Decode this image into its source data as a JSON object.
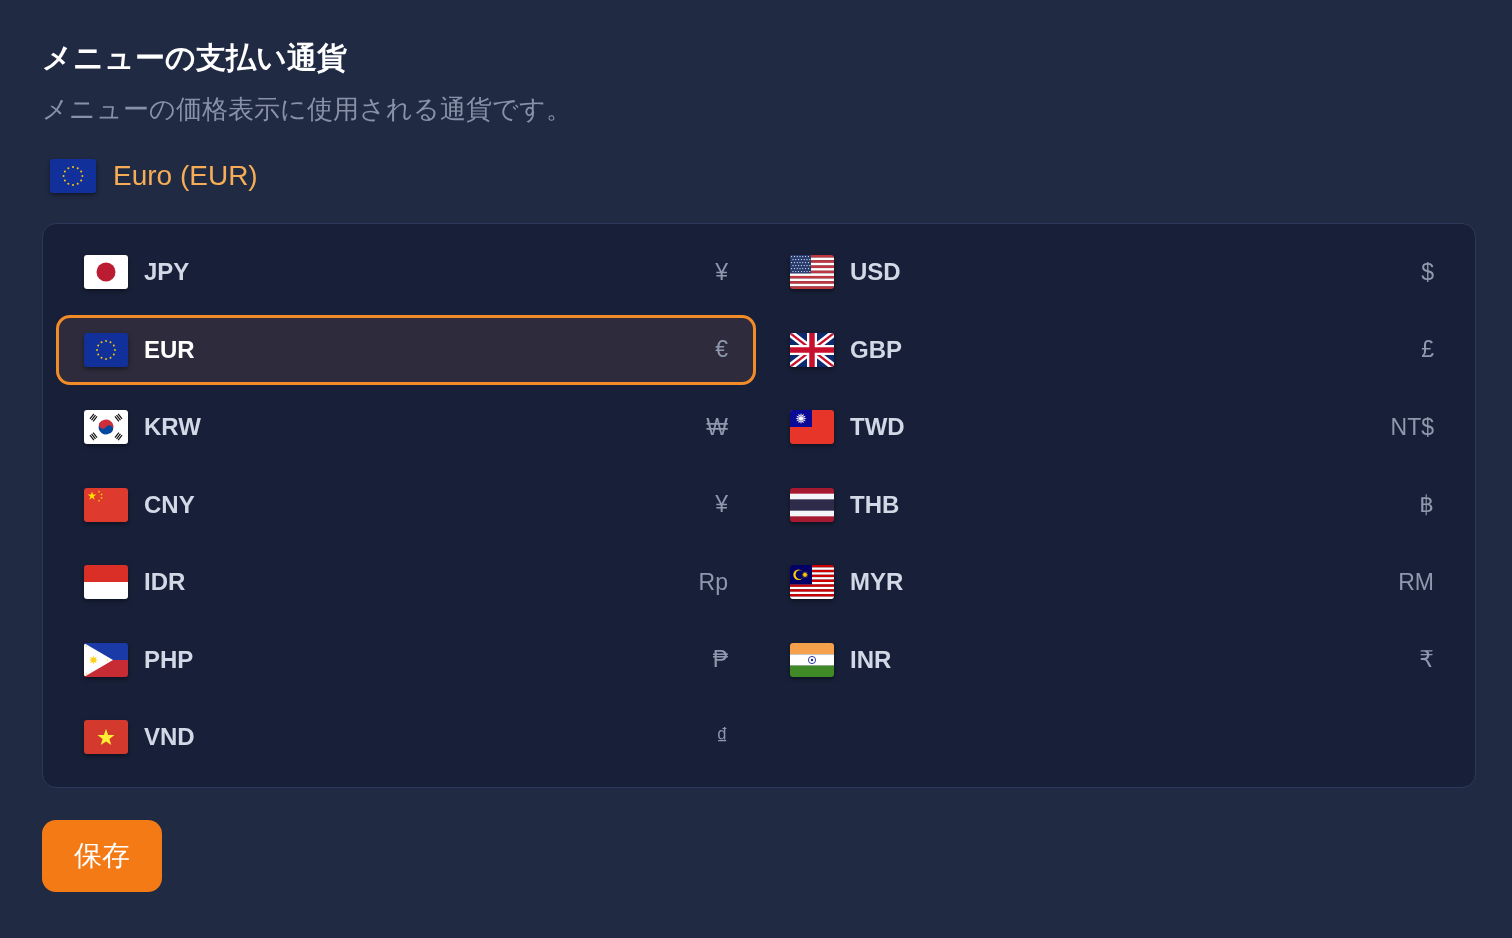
{
  "header": {
    "title": "メニューの支払い通貨",
    "description": "メニューの価格表示に使用される通貨です。"
  },
  "current_currency": {
    "label": "Euro (EUR)"
  },
  "currencies": [
    {
      "code": "JPY",
      "symbol": "¥",
      "selected": false
    },
    {
      "code": "USD",
      "symbol": "$",
      "selected": false
    },
    {
      "code": "EUR",
      "symbol": "€",
      "selected": true
    },
    {
      "code": "GBP",
      "symbol": "£",
      "selected": false
    },
    {
      "code": "KRW",
      "symbol": "₩",
      "selected": false
    },
    {
      "code": "TWD",
      "symbol": "NT$",
      "selected": false
    },
    {
      "code": "CNY",
      "symbol": "¥",
      "selected": false
    },
    {
      "code": "THB",
      "symbol": "฿",
      "selected": false
    },
    {
      "code": "IDR",
      "symbol": "Rp",
      "selected": false
    },
    {
      "code": "MYR",
      "symbol": "RM",
      "selected": false
    },
    {
      "code": "PHP",
      "symbol": "₱",
      "selected": false
    },
    {
      "code": "INR",
      "symbol": "₹",
      "selected": false
    },
    {
      "code": "VND",
      "symbol": "₫",
      "selected": false
    }
  ],
  "save_button": {
    "label": "保存"
  }
}
